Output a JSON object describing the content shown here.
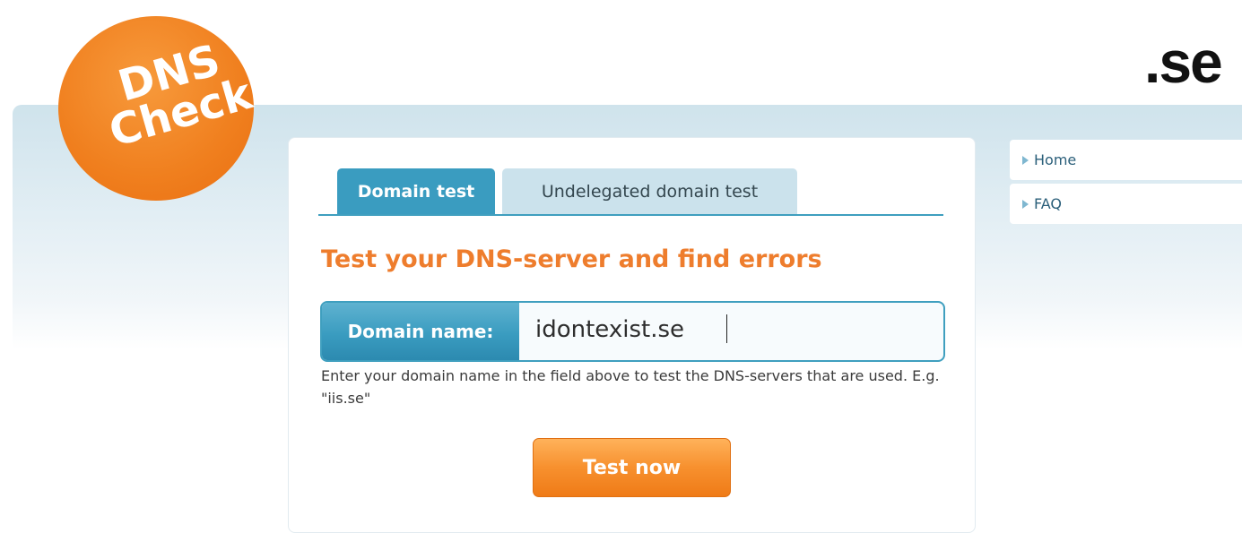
{
  "logo": {
    "line1": "DNS",
    "line2": "Check"
  },
  "brand": ".se",
  "tabs": [
    {
      "label": "Domain test",
      "active": true
    },
    {
      "label": "Undelegated domain test",
      "active": false
    }
  ],
  "main": {
    "title": "Test your DNS-server and find errors",
    "field_label": "Domain name:",
    "field_value": "idontexist.se",
    "hint": "Enter your domain name in the field above to test the DNS-servers that are used. E.g. \"iis.se\"",
    "button_label": "Test now"
  },
  "nav": [
    {
      "label": "Home"
    },
    {
      "label": "FAQ"
    }
  ],
  "colors": {
    "accent_orange": "#ee7d2d",
    "accent_blue": "#3a9cc0"
  }
}
